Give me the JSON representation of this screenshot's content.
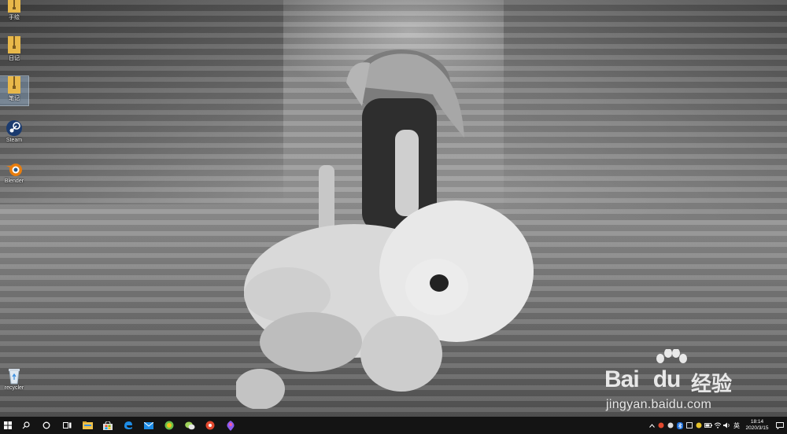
{
  "desktop": {
    "icons": [
      {
        "label": "手绘",
        "icon": "zip-folder-icon"
      },
      {
        "label": "日记",
        "icon": "zip-folder-icon"
      },
      {
        "label": "笔记",
        "icon": "zip-folder-icon",
        "selected": true
      },
      {
        "label": "Steam",
        "icon": "steam-icon"
      },
      {
        "label": "Blender",
        "icon": "blender-icon"
      },
      {
        "label": "recycler",
        "icon": "recycle-bin-icon"
      }
    ]
  },
  "watermark": {
    "brand": "Bai",
    "brand2": "du",
    "cn": "经验",
    "url": "jingyan.baidu.com"
  },
  "taskbar": {
    "apps": [
      "start-icon",
      "search-icon",
      "cortana-icon",
      "task-view-icon",
      "file-explorer-icon",
      "store-icon",
      "edge-icon",
      "mail-icon",
      "360-browser-icon",
      "wechat-icon",
      "app-red-icon",
      "app-paint-icon"
    ],
    "tray": {
      "ime": "英",
      "time": "18:14",
      "date": "2020/3/15"
    }
  },
  "colors": {
    "taskbar_bg": "#141414",
    "folder_yellow": "#e8b84a",
    "accent_blue": "#3b8fe0"
  }
}
